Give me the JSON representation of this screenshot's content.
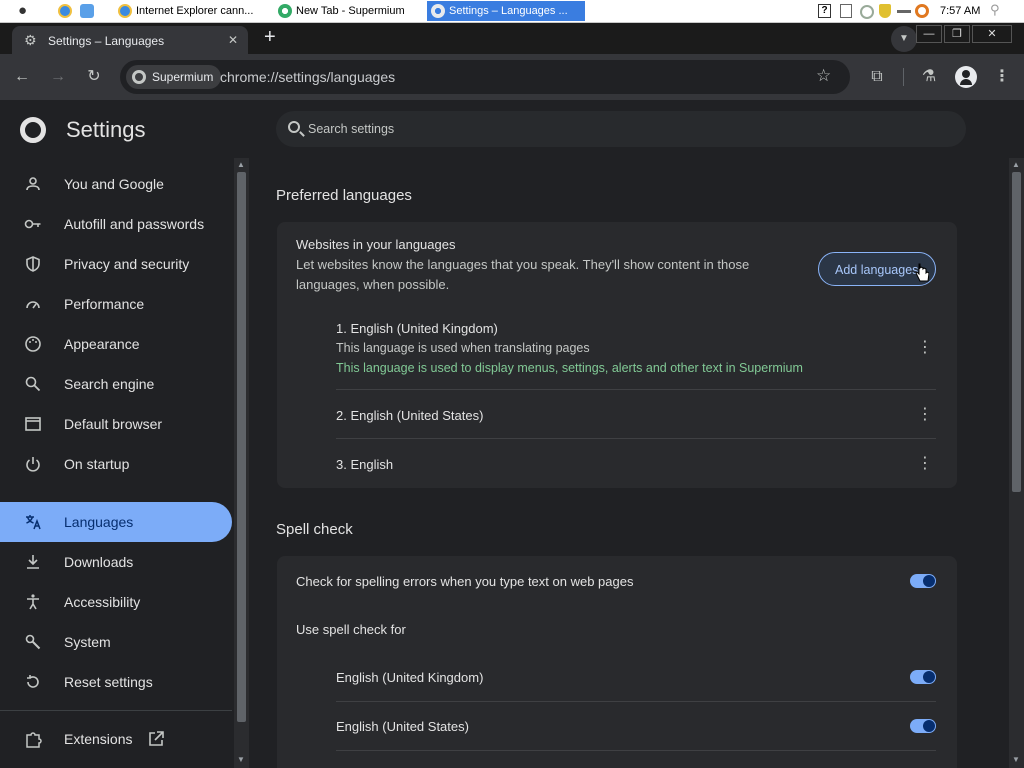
{
  "taskbar": {
    "tasks": [
      {
        "label": "Internet Explorer cann..."
      },
      {
        "label": "New Tab - Supermium"
      },
      {
        "label": "Settings – Languages ..."
      }
    ],
    "clock": "7:57 AM",
    "tray_question": "?"
  },
  "browser": {
    "tab_title": "Settings – Languages",
    "tab_close": "✕",
    "new_tab": "+",
    "chip_label": "Supermium",
    "url": "chrome://settings/languages"
  },
  "settings": {
    "title": "Settings",
    "search_placeholder": "Search settings",
    "sidebar": [
      {
        "label": "You and Google"
      },
      {
        "label": "Autofill and passwords"
      },
      {
        "label": "Privacy and security"
      },
      {
        "label": "Performance"
      },
      {
        "label": "Appearance"
      },
      {
        "label": "Search engine"
      },
      {
        "label": "Default browser"
      },
      {
        "label": "On startup"
      },
      {
        "label": "Languages"
      },
      {
        "label": "Downloads"
      },
      {
        "label": "Accessibility"
      },
      {
        "label": "System"
      },
      {
        "label": "Reset settings"
      },
      {
        "label": "Extensions"
      }
    ],
    "preferred": {
      "heading": "Preferred languages",
      "card_title": "Websites in your languages",
      "card_desc_line1": "Let websites know the languages that you speak. They'll show content in those",
      "card_desc_line2": "languages, when possible.",
      "add_button": "Add languages",
      "languages": [
        {
          "name": "1. English (United Kingdom)",
          "note1": "This language is used when translating pages",
          "note2": "This language is used to display menus, settings, alerts and other text in Supermium"
        },
        {
          "name": "2. English (United States)"
        },
        {
          "name": "3. English"
        }
      ]
    },
    "spell": {
      "heading": "Spell check",
      "check_label": "Check for spelling errors when you type text on web pages",
      "use_for": "Use spell check for",
      "langs": [
        {
          "label": "English (United Kingdom)"
        },
        {
          "label": "English (United States)"
        }
      ]
    }
  },
  "colors": {
    "accent": "#7cacf8",
    "green_note": "#81c995",
    "page_bg": "#202124",
    "card_bg": "#292a2d"
  }
}
